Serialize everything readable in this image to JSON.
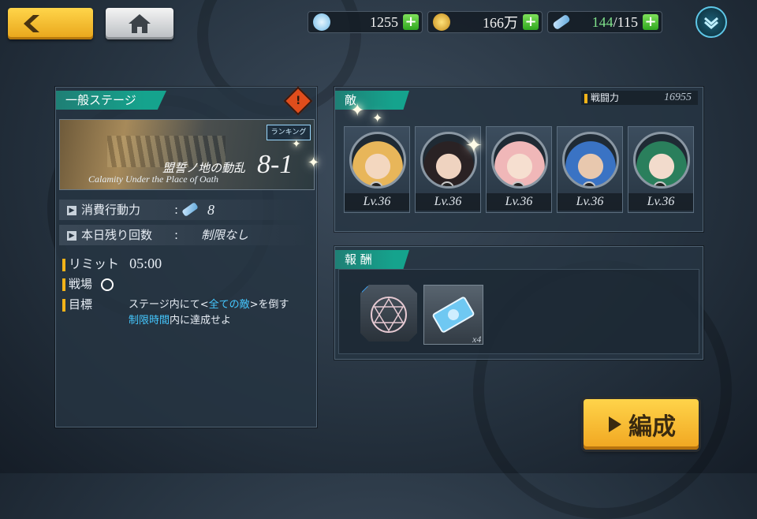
{
  "topbar": {
    "back_icon": "chevron-left-icon",
    "home_icon": "house-icon",
    "gems": "1255",
    "gold": "166万",
    "stamina_current": "144",
    "stamina_sep": "/",
    "stamina_max": "115",
    "menu_icon": "chevron-down-icon"
  },
  "stage": {
    "tab": "一般ステージ",
    "alert_icon": "warning-icon",
    "ranking_badge": "ランキング",
    "title_jp": "盟誓ノ地の動乱",
    "title_en": "Calamity Under the Place of Oath",
    "number": "8-1",
    "cost_label": "消費行動力",
    "cost_colon": ":",
    "cost_value": "8",
    "remaining_label": "本日残り回数",
    "remaining_colon": ":",
    "remaining_value": "制限なし",
    "limit_label": "リミット",
    "limit_value": "05:00",
    "field_label": "戦場",
    "goal_label": "目標",
    "goal_line1_a": "ステージ内にて<",
    "goal_line1_hl": "全ての敵",
    "goal_line1_b": ">を倒す",
    "goal_line2_hl": "制限時間",
    "goal_line2_b": "内に達成せよ"
  },
  "enemies": {
    "tab": "敵",
    "power_label": "戦闘力",
    "power_value": "16955",
    "list": [
      {
        "level": "Lv.36",
        "hair": "#e8b65a",
        "skin": "#f3d7bf"
      },
      {
        "level": "Lv.36",
        "hair": "#2a2224",
        "skin": "#efd3c0"
      },
      {
        "level": "Lv.36",
        "hair": "#f0b7b8",
        "skin": "#f6dfd0"
      },
      {
        "level": "Lv.36",
        "hair": "#3a73c4",
        "skin": "#e8c8ae"
      },
      {
        "level": "Lv.36",
        "hair": "#2a7f5c",
        "skin": "#f2dbcc"
      }
    ]
  },
  "rewards": {
    "tab": "報 酬",
    "items": [
      {
        "icon": "magic-circle-icon",
        "count": ""
      },
      {
        "icon": "ticket-icon",
        "count": "x4"
      }
    ]
  },
  "organize_button": "編成",
  "colors": {
    "accent_teal": "#15a38d",
    "accent_gold": "#f0a520",
    "highlight": "#45c8ff"
  }
}
